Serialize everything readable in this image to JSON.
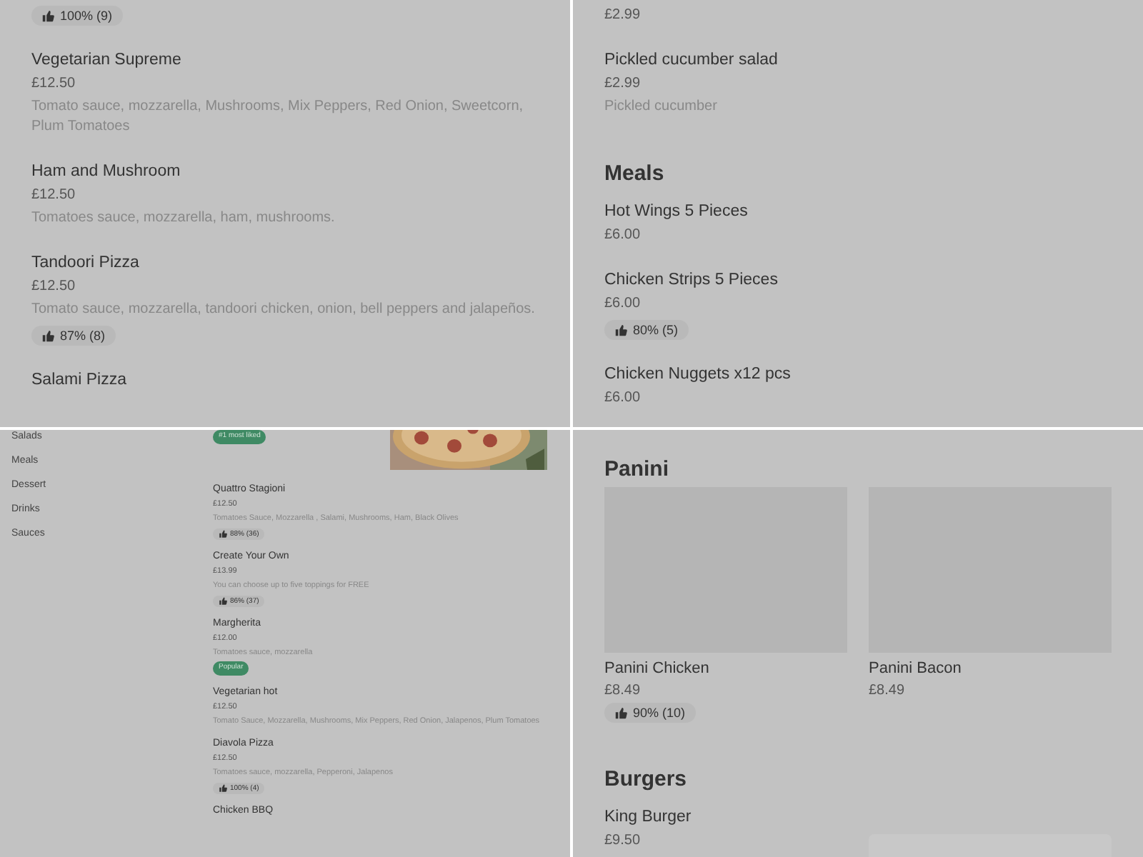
{
  "panels": [
    {
      "kind": "menu",
      "blocks": [
        {
          "kind": "rating",
          "rating": "100% (9)"
        },
        {
          "kind": "item",
          "name": "Vegetarian Supreme",
          "price": "£12.50",
          "description": "Tomato sauce, mozzarella, Mushrooms, Mix Peppers, Red Onion, Sweetcorn, Plum Tomatoes"
        },
        {
          "kind": "item",
          "name": "Ham and Mushroom",
          "price": "£12.50",
          "description": "Tomatoes sauce, mozzarella, ham, mushrooms."
        },
        {
          "kind": "item",
          "name": "Tandoori Pizza",
          "price": "£12.50",
          "description": "Tomato sauce, mozzarella, tandoori chicken, onion, bell peppers and jalapeños.",
          "rating": "87% (8)"
        },
        {
          "kind": "item",
          "name": "Salami Pizza"
        }
      ]
    },
    {
      "kind": "menu",
      "blocks": [
        {
          "kind": "price",
          "price": "£2.99"
        },
        {
          "kind": "item",
          "name": "Pickled cucumber salad",
          "price": "£2.99",
          "description": "Pickled cucumber"
        },
        {
          "kind": "heading",
          "title": "Meals"
        },
        {
          "kind": "item",
          "name": "Hot Wings 5 Pieces",
          "price": "£6.00"
        },
        {
          "kind": "item",
          "name": "Chicken Strips 5 Pieces",
          "price": "£6.00",
          "rating": "80% (5)"
        },
        {
          "kind": "item",
          "name": "Chicken Nuggets x12 pcs",
          "price": "£6.00"
        }
      ]
    },
    {
      "kind": "sidebar",
      "nav": [
        "Salads",
        "Meals",
        "Dessert",
        "Drinks",
        "Sauces"
      ],
      "blocks": [
        {
          "kind": "badge",
          "badge": "#1 most liked"
        },
        {
          "kind": "item",
          "name": "Quattro Stagioni",
          "price": "£12.50",
          "description": "Tomatoes Sauce, Mozzarella , Salami, Mushrooms, Ham, Black Olives",
          "rating": "88% (36)"
        },
        {
          "kind": "item",
          "name": "Create Your Own",
          "price": "£13.99",
          "description": "You can choose up to five toppings for FREE",
          "rating": "86% (37)"
        },
        {
          "kind": "item",
          "name": "Margherita",
          "price": "£12.00",
          "description": "Tomatoes sauce, mozzarella",
          "badge": "Popular"
        },
        {
          "kind": "item",
          "name": "Vegetarian hot",
          "price": "£12.50",
          "description": "Tomato Sauce, Mozzarella, Mushrooms, Mix Peppers, Red Onion, Jalapenos, Plum Tomatoes"
        },
        {
          "kind": "item",
          "name": "Diavola Pizza",
          "price": "£12.50",
          "description": "Tomatoes sauce, mozzarella, Pepperoni, Jalapenos",
          "rating": "100% (4)"
        },
        {
          "kind": "item",
          "name": "Chicken BBQ"
        }
      ]
    },
    {
      "kind": "menu",
      "blocks": [
        {
          "kind": "heading",
          "title": "Panini"
        },
        {
          "kind": "cards",
          "cards": [
            {
              "name": "Panini Chicken",
              "price": "£8.49",
              "rating": "90% (10)"
            },
            {
              "name": "Panini Bacon",
              "price": "£8.49"
            }
          ]
        },
        {
          "kind": "heading",
          "title": "Burgers"
        },
        {
          "kind": "item",
          "name": "King Burger",
          "price": "£9.50",
          "image": true
        }
      ]
    }
  ]
}
